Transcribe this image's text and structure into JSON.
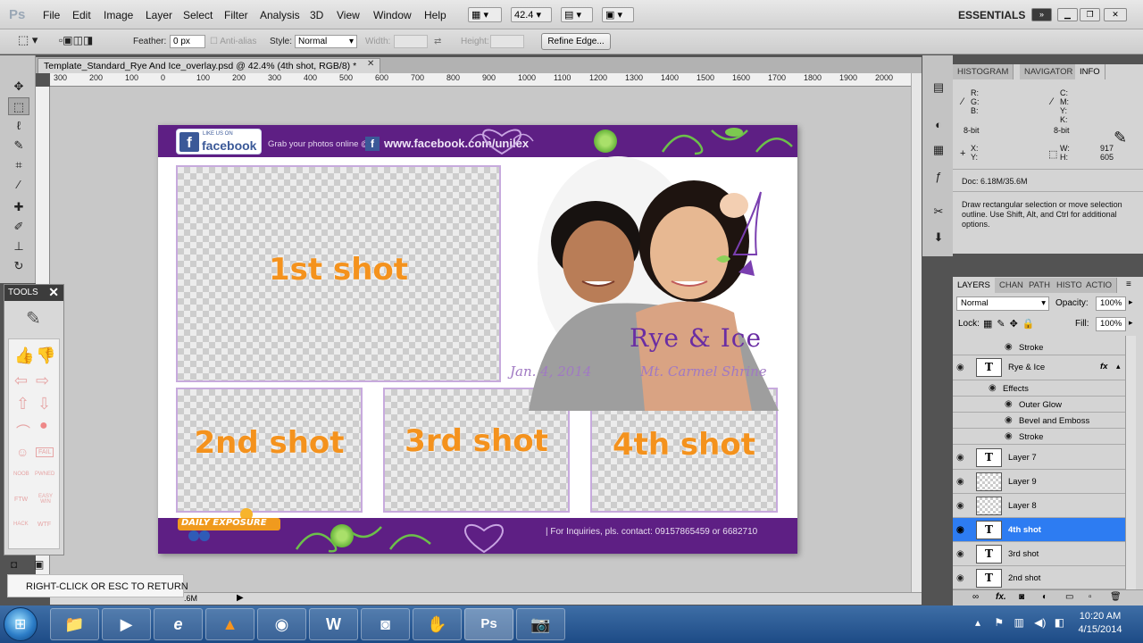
{
  "app": {
    "logo": "Ps"
  },
  "menu": {
    "items": [
      "File",
      "Edit",
      "Image",
      "Layer",
      "Select",
      "Filter",
      "Analysis",
      "3D",
      "View",
      "Window",
      "Help"
    ]
  },
  "appbar": {
    "zoom": "42.4",
    "workspace": "ESSENTIALS"
  },
  "window_controls": {
    "minimize_glyph": "▁",
    "restore_glyph": "❐",
    "close_glyph": "✕"
  },
  "options": {
    "feather_label": "Feather:",
    "feather_value": "0 px",
    "antialias_label": "Anti-alias",
    "style_label": "Style:",
    "style_value": "Normal",
    "width_label": "Width:",
    "height_label": "Height:",
    "refine_label": "Refine Edge..."
  },
  "document": {
    "tab_title": "Template_Standard_Rye And Ice_overlay.psd @ 42.4% (4th shot, RGB/8) *",
    "tab_close": "✕",
    "ruler_labels": [
      "300",
      "200",
      "100",
      "0",
      "100",
      "200",
      "300",
      "400",
      "500",
      "600",
      "700",
      "800",
      "900",
      "1000",
      "1100",
      "1200",
      "1300",
      "1400",
      "1500",
      "1600",
      "1700",
      "1800",
      "1900",
      "2000"
    ],
    "status_text": ".6M"
  },
  "artwork": {
    "fb_likes": "LIKE US ON",
    "fb_word": "facebook",
    "fb_f": "f",
    "grab_text": "Grab your photos online @",
    "fb_url": "www.facebook.com/unilex",
    "shot1": "1st shot",
    "shot2": "2nd shot",
    "shot3": "3rd shot",
    "shot4": "4th shot",
    "couple_title": "Rye & Ice",
    "date": "Jan. 4, 2014",
    "venue": "Mt. Carmel Shrine",
    "inquiries": "| For Inquiries, pls. contact: 09157865459 or 6682710",
    "brand": "DAILY EXPOSURE"
  },
  "info_panel": {
    "tabs": [
      "HISTOGRAM",
      "NAVIGATOR",
      "INFO"
    ],
    "r": "R:",
    "g": "G:",
    "b": "B:",
    "c": "C:",
    "m": "M:",
    "y": "Y:",
    "k": "K:",
    "bit_left": "8-bit",
    "bit_right": "8-bit",
    "x": "X:",
    "yy": "Y:",
    "w": "W:",
    "h": "H:",
    "w_val": "917",
    "h_val": "605",
    "doc_size": "Doc: 6.18M/35.6M",
    "hint": "Draw rectangular selection or move selection outline.  Use Shift, Alt, and Ctrl for additional options."
  },
  "layers_panel": {
    "tabs": [
      "LAYERS",
      "CHAN",
      "PATH",
      "HISTO",
      "ACTIO"
    ],
    "blend_mode": "Normal",
    "opacity_label": "Opacity:",
    "opacity_value": "100%",
    "lock_label": "Lock:",
    "fill_label": "Fill:",
    "fill_value": "100%",
    "rows": [
      {
        "name": "Stroke",
        "kind": "effect-item"
      },
      {
        "name": "Rye & Ice",
        "kind": "text",
        "fx": "fx"
      },
      {
        "name": "Effects",
        "kind": "effects-header"
      },
      {
        "name": "Outer Glow",
        "kind": "effect-item"
      },
      {
        "name": "Bevel and Emboss",
        "kind": "effect-item"
      },
      {
        "name": "Stroke",
        "kind": "effect-item"
      },
      {
        "name": "Layer 7",
        "kind": "text"
      },
      {
        "name": "Layer 9",
        "kind": "raster"
      },
      {
        "name": "Layer 8",
        "kind": "raster"
      },
      {
        "name": "4th shot",
        "kind": "text",
        "selected": true
      },
      {
        "name": "3rd shot",
        "kind": "text"
      },
      {
        "name": "2nd shot",
        "kind": "text"
      }
    ],
    "thumb_letter": "T"
  },
  "tools_panel": {
    "title": "TOOLS",
    "close": "✕"
  },
  "stickers": [
    "NOOB",
    "PWNED",
    "FTW",
    "EASY WIN",
    "HACK",
    "WTF",
    "FAIL"
  ],
  "banner": {
    "text": "RIGHT-CLICK OR ESC TO RETURN"
  },
  "taskbar": {
    "time": "10:20 AM",
    "date": "4/15/2014",
    "ps_label": "Ps",
    "word_label": "W"
  }
}
